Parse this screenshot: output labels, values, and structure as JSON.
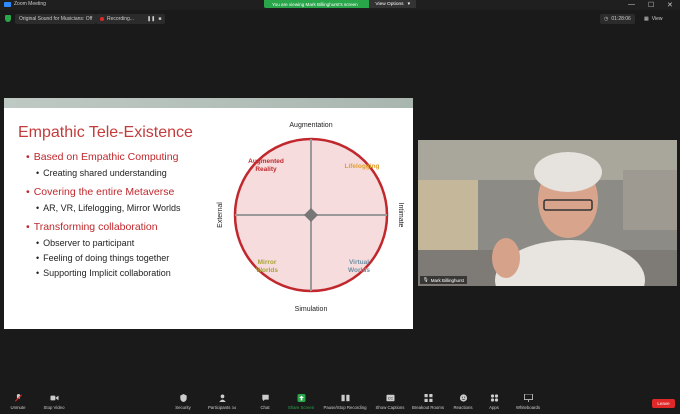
{
  "window": {
    "title": "Zoom Meeting",
    "minimize": "—",
    "maximize": "☐",
    "close": "✕"
  },
  "banner": {
    "text": "You are viewing Mark Billinghurst's screen",
    "options": "View Options"
  },
  "topbar": {
    "audio": "Original Sound for Musicians: Off",
    "recording": "Recording...",
    "timer": "01:28:06",
    "view": "View"
  },
  "slide": {
    "title": "Empathic Tele-Existence",
    "bullets": [
      {
        "text": "Based on Empathic Computing",
        "sub": [
          "Creating shared understanding"
        ]
      },
      {
        "text": "Covering the entire Metaverse",
        "sub": [
          "AR, VR, Lifelogging, Mirror Worlds"
        ]
      },
      {
        "text": "Transforming collaboration",
        "sub": [
          "Observer to participant",
          "Feeling of doing things together",
          "Supporting Implicit collaboration"
        ]
      }
    ],
    "diagram": {
      "top": "Augmentation",
      "bottom": "Simulation",
      "left": "External",
      "right": "Intimate",
      "q_top_left": [
        "Augmented",
        "Reality"
      ],
      "q_top_right": "Lifelogging",
      "q_bottom_left": [
        "Mirror",
        "Worlds"
      ],
      "q_bottom_right": [
        "Virtual",
        "Worlds"
      ]
    }
  },
  "video": {
    "name": "Mark Billinghurst"
  },
  "toolbar": {
    "unmute": "Unmute",
    "stop_video": "Stop Video",
    "security": "Security",
    "participants": "Participants",
    "participants_count": "34",
    "chat": "Chat",
    "share": "Share Screen",
    "record": "Pause/Stop Recording",
    "captions": "Show Captions",
    "breakout": "Breakout Rooms",
    "reactions": "Reactions",
    "apps": "Apps",
    "whiteboards": "Whiteboards",
    "leave": "Leave"
  },
  "colors": {
    "share_green": "#2aa64a",
    "leave_red": "#e02828",
    "slide_red": "#c0282d"
  }
}
